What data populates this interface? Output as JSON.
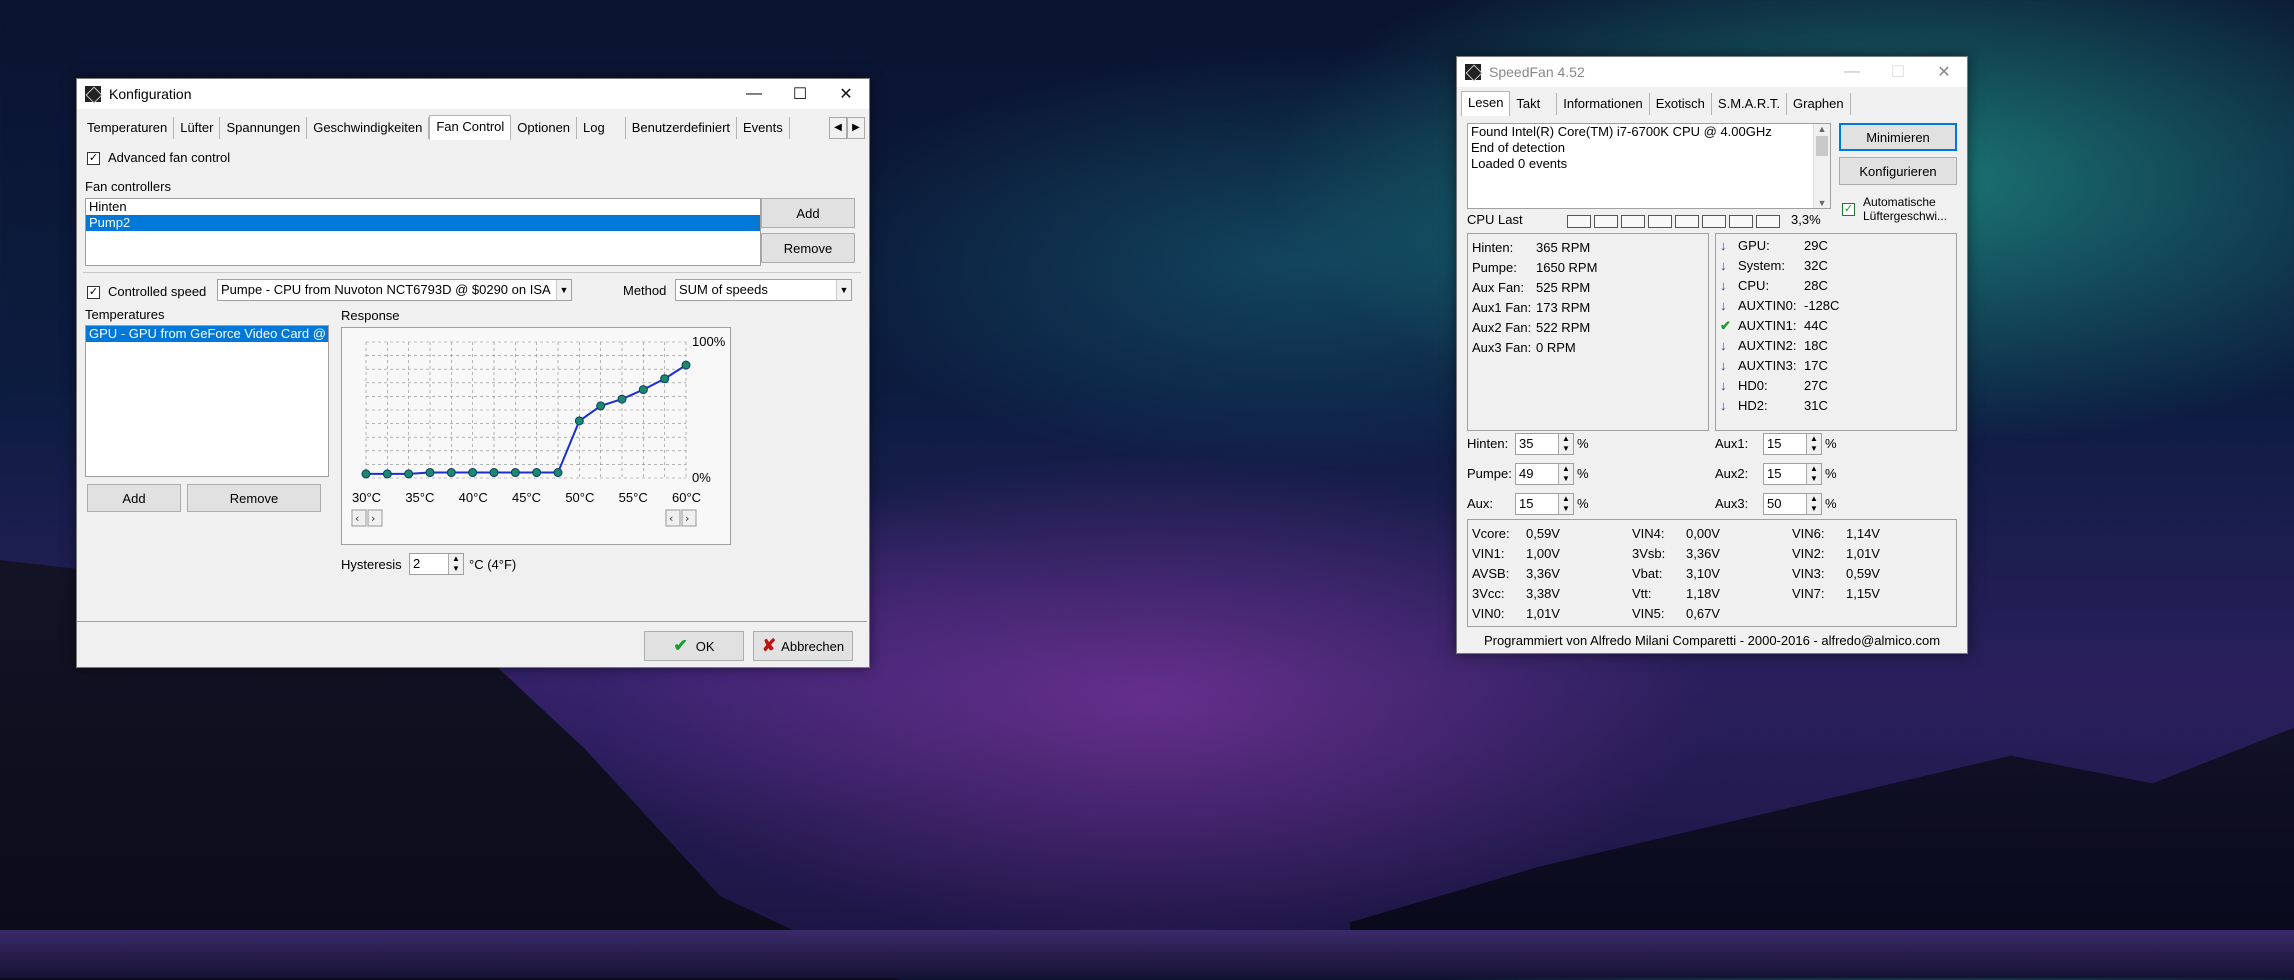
{
  "konfig": {
    "title": "Konfiguration",
    "tabs": [
      "Temperaturen",
      "Lüfter",
      "Spannungen",
      "Geschwindigkeiten",
      "Fan Control",
      "Optionen",
      "Log",
      "Benutzerdefiniert",
      "Events"
    ],
    "advanced_fan_control": "Advanced fan control",
    "fan_controllers_label": "Fan controllers",
    "controllers": [
      "Hinten",
      "Pump2"
    ],
    "add": "Add",
    "remove": "Remove",
    "controlled_speed": "Controlled speed",
    "speed_source": "Pumpe - CPU from Nuvoton NCT6793D @ $0290 on ISA",
    "method_label": "Method",
    "method_value": "SUM of speeds",
    "temperatures_label": "Temperatures",
    "temperatures": [
      "GPU - GPU from GeForce Video Card @"
    ],
    "response_label": "Response",
    "hysteresis_label": "Hysteresis",
    "hysteresis_value": "2",
    "hysteresis_unit": "°C (4°F)",
    "ok": "OK",
    "cancel": "Abbrechen"
  },
  "chart_data": {
    "type": "line",
    "xlabel": "",
    "ylabel": "",
    "x_tick_labels": [
      "30°C",
      "35°C",
      "40°C",
      "45°C",
      "50°C",
      "55°C",
      "60°C"
    ],
    "y_tick_labels": [
      "0%",
      "100%"
    ],
    "x": [
      30,
      32,
      34,
      36,
      38,
      40,
      42,
      44,
      46,
      48,
      50,
      52,
      54,
      56,
      58,
      60
    ],
    "y": [
      3,
      3,
      3,
      4,
      4,
      4,
      4,
      4,
      4,
      4,
      42,
      53,
      58,
      65,
      73,
      83
    ],
    "xlim": [
      30,
      60
    ],
    "ylim": [
      0,
      100
    ],
    "grid": true,
    "line_color": "#1a2fd0",
    "point_color": "#1a8a6a"
  },
  "speedfan": {
    "title": "SpeedFan 4.52",
    "tabs": [
      "Lesen",
      "Takt",
      "Informationen",
      "Exotisch",
      "S.M.A.R.T.",
      "Graphen"
    ],
    "log_lines": [
      "Found Intel(R) Core(TM) i7-6700K CPU @ 4.00GHz",
      "End of detection",
      "Loaded 0 events"
    ],
    "btn_minimize": "Minimieren",
    "btn_config": "Konfigurieren",
    "auto_fan": "Automatische Lüftergeschwi...",
    "cpu_last_label": "CPU Last",
    "cpu_last_value": "3,3%",
    "cpu_last_fraction": 0.033,
    "fans": [
      {
        "name": "Hinten:",
        "value": "365 RPM"
      },
      {
        "name": "Pumpe:",
        "value": "1650 RPM"
      },
      {
        "name": "Aux Fan:",
        "value": "525 RPM"
      },
      {
        "name": "Aux1 Fan:",
        "value": "173 RPM"
      },
      {
        "name": "Aux2 Fan:",
        "value": "522 RPM"
      },
      {
        "name": "Aux3 Fan:",
        "value": "0 RPM"
      }
    ],
    "temps": [
      {
        "icon": "arrow-down",
        "name": "GPU:",
        "value": "29C"
      },
      {
        "icon": "arrow-down",
        "name": "System:",
        "value": "32C"
      },
      {
        "icon": "arrow-down",
        "name": "CPU:",
        "value": "28C"
      },
      {
        "icon": "arrow-down",
        "name": "AUXTIN0:",
        "value": "-128C"
      },
      {
        "icon": "check",
        "name": "AUXTIN1:",
        "value": "44C"
      },
      {
        "icon": "arrow-down",
        "name": "AUXTIN2:",
        "value": "18C"
      },
      {
        "icon": "arrow-down",
        "name": "AUXTIN3:",
        "value": "17C"
      },
      {
        "icon": "arrow-down",
        "name": "HD0:",
        "value": "27C"
      },
      {
        "icon": "arrow-down",
        "name": "HD2:",
        "value": "31C"
      }
    ],
    "speeds_left": [
      {
        "name": "Hinten:",
        "value": "35"
      },
      {
        "name": "Pumpe:",
        "value": "49"
      },
      {
        "name": "Aux:",
        "value": "15"
      }
    ],
    "speeds_right": [
      {
        "name": "Aux1:",
        "value": "15"
      },
      {
        "name": "Aux2:",
        "value": "15"
      },
      {
        "name": "Aux3:",
        "value": "50"
      }
    ],
    "percent": "%",
    "voltages_col1": [
      {
        "name": "Vcore:",
        "value": "0,59V"
      },
      {
        "name": "VIN1:",
        "value": "1,00V"
      },
      {
        "name": "AVSB:",
        "value": "3,36V"
      },
      {
        "name": "3Vcc:",
        "value": "3,38V"
      },
      {
        "name": "VIN0:",
        "value": "1,01V"
      }
    ],
    "voltages_col2": [
      {
        "name": "VIN4:",
        "value": "0,00V"
      },
      {
        "name": "3Vsb:",
        "value": "3,36V"
      },
      {
        "name": "Vbat:",
        "value": "3,10V"
      },
      {
        "name": "Vtt:",
        "value": "1,18V"
      },
      {
        "name": "VIN5:",
        "value": "0,67V"
      }
    ],
    "voltages_col3": [
      {
        "name": "VIN6:",
        "value": "1,14V"
      },
      {
        "name": "VIN2:",
        "value": "1,01V"
      },
      {
        "name": "VIN3:",
        "value": "0,59V"
      },
      {
        "name": "VIN7:",
        "value": "1,15V"
      }
    ],
    "status": "Programmiert von Alfredo Milani Comparetti - 2000-2016 - alfredo@almico.com"
  }
}
